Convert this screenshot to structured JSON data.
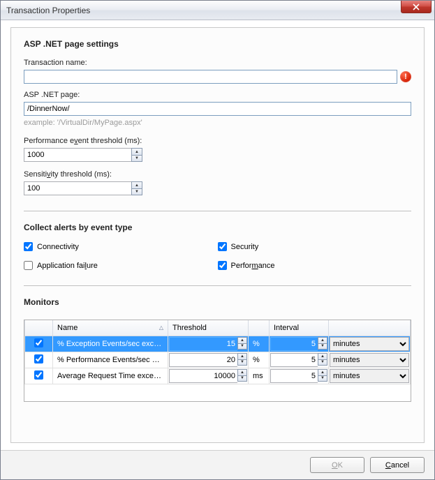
{
  "window": {
    "title": "Transaction Properties"
  },
  "section_settings": {
    "title": "ASP .NET page settings"
  },
  "fields": {
    "transaction_name": {
      "label": "Transaction name:",
      "value": "",
      "error_tooltip": "!"
    },
    "asp_page": {
      "label": "ASP .NET page:",
      "value": "/DinnerNow/",
      "hint": "example: '/VirtualDir/MyPage.aspx'"
    },
    "perf_threshold": {
      "label": "Performance event threshold (ms):",
      "value": "1000"
    },
    "sensitivity": {
      "label": "Sensitivity threshold (ms):",
      "value": "100"
    }
  },
  "section_alerts": {
    "title": "Collect alerts by event type"
  },
  "alerts": {
    "connectivity": {
      "label": "Connectivity",
      "checked": true
    },
    "security": {
      "label": "Security",
      "checked": true
    },
    "app_failure": {
      "label": "Application failure",
      "checked": false
    },
    "performance": {
      "label": "Performance",
      "checked": true
    }
  },
  "section_monitors": {
    "title": "Monitors"
  },
  "monitors_headers": {
    "name": "Name",
    "threshold": "Threshold",
    "interval": "Interval"
  },
  "monitors": [
    {
      "checked": true,
      "selected": true,
      "name": "% Exception Events/sec excee...",
      "threshold": "15",
      "unit": "%",
      "interval": "5",
      "interval_unit": "minutes"
    },
    {
      "checked": true,
      "selected": false,
      "name": "% Performance Events/sec exc...",
      "threshold": "20",
      "unit": "%",
      "interval": "5",
      "interval_unit": "minutes"
    },
    {
      "checked": true,
      "selected": false,
      "name": "Average Request Time exceed...",
      "threshold": "10000",
      "unit": "ms",
      "interval": "5",
      "interval_unit": "minutes"
    }
  ],
  "buttons": {
    "ok": "OK",
    "cancel": "Cancel"
  }
}
